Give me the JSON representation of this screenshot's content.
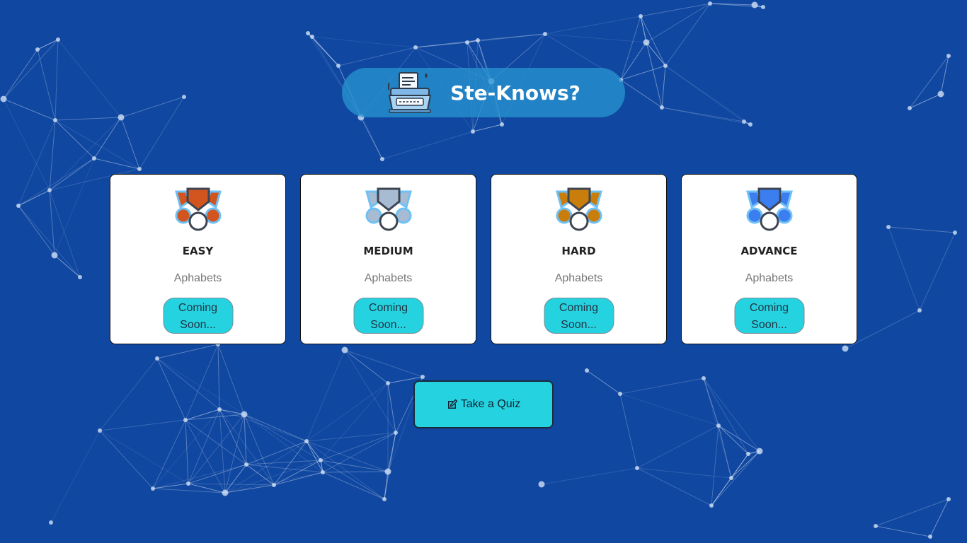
{
  "header": {
    "title": "Ste-Knows?",
    "logo_icon": "typewriter-icon"
  },
  "levels": [
    {
      "level": "EASY",
      "subtitle": "Aphabets",
      "button_label": "Coming Soon...",
      "medal_color": "#d2541e",
      "medal_icon": "medal-icon"
    },
    {
      "level": "MEDIUM",
      "subtitle": "Aphabets",
      "button_label": "Coming Soon...",
      "medal_color": "#a7bcd3",
      "medal_icon": "medal-icon"
    },
    {
      "level": "HARD",
      "subtitle": "Aphabets",
      "button_label": "Coming Soon...",
      "medal_color": "#c97e0b",
      "medal_icon": "medal-icon"
    },
    {
      "level": "ADVANCE",
      "subtitle": "Aphabets",
      "button_label": "Coming Soon...",
      "medal_color": "#3b7ef0",
      "medal_icon": "medal-icon"
    }
  ],
  "quiz_button": {
    "label": "Take a Quiz",
    "icon": "edit-icon"
  },
  "colors": {
    "background": "#0f47a1",
    "accent": "#25d3e0",
    "header_pill": "#2896d2"
  }
}
